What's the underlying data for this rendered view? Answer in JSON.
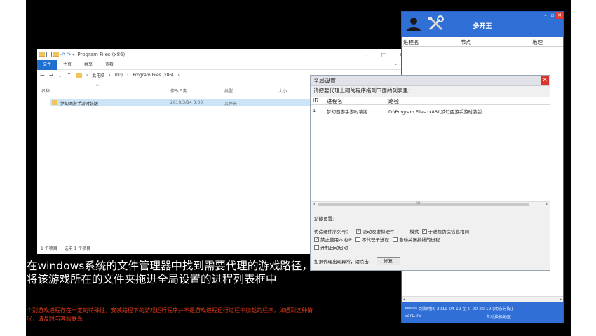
{
  "explorer": {
    "path_title": "Program Files (x86)",
    "tabs": [
      "文件",
      "主页",
      "共享",
      "查看"
    ],
    "address": [
      "此电脑",
      "(D:)",
      "Program Files (x86)"
    ],
    "columns": [
      "名称",
      "修改日期",
      "类型",
      "大小"
    ],
    "rows": [
      {
        "name": "梦幻西游手游时装版",
        "modified": "2019/3/14 0:00",
        "type": "文件夹",
        "size": ""
      }
    ],
    "status": [
      "1 个项目",
      "选中 1 个项目"
    ]
  },
  "dialog": {
    "title": "全局设置",
    "instruction": "请把要代理上网的程序拖到下面的列表里：",
    "columns": [
      "ID",
      "进程名",
      "路径"
    ],
    "rows": [
      {
        "id": "1",
        "process": "梦幻西游手游时装版",
        "path": "D:\\Program Files (x86)\\梦幻西游手游时装版"
      }
    ],
    "func_label": "功能设置:",
    "option_line1_label": "伪造硬件序列号：",
    "opt_driver": "驱动及虚拟硬件",
    "mode_label": "模式",
    "opt_child_same": "子进程伪造信息相同",
    "opt_disable_local_ip": "禁止使用本地IP",
    "opt_no_proxy_child": "不代理子进程",
    "opt_auto_close": "自动关闭掉线的进程",
    "opt_autostart": "开机自动启动",
    "repair_hint": "如果代理出现异常，请点击：",
    "repair_button": "修复"
  },
  "app": {
    "title": "多开王",
    "columns": [
      "进程名",
      "节点",
      "地理"
    ],
    "footer_line1": "****** 到期时间 2019-04-12 至 0-20-20.19 [动态分配]",
    "footer_version": "Ver1.06",
    "footer_region": "自动换换地区"
  },
  "caption": "在windows系统的文件管理器中找到需要代理的游戏路径，将该游戏所在的文件夹拖进全局设置的进程列表框中",
  "note": "个别游戏进程存在一定的特殊性，安装路径下的游戏运行程序并不是游戏进程运行过程中加载的程序，如遇到这种情况，请及时与客服联系",
  "colors": {
    "accent": "#2f6fd6",
    "note_red": "#e03a1a",
    "dialog_close": "#d9342b"
  }
}
